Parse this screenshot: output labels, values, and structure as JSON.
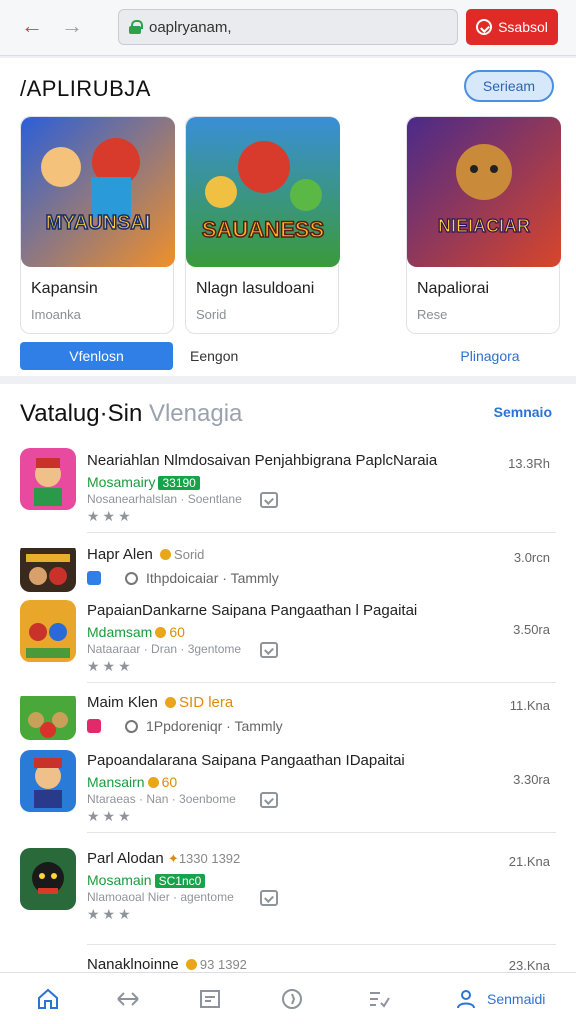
{
  "browser": {
    "url": "oaplryanam,",
    "subscribe_label": "Ssabsol"
  },
  "featured": {
    "title": "/APLIRUBJA",
    "button_label": "Serieam",
    "cards": [
      {
        "name": "Kapansin",
        "sub": "Imoanka",
        "art_text": "MYAUNSAI"
      },
      {
        "name": "Nlagn lasuldoani",
        "sub": "Sorid",
        "art_text": "SAUANESS"
      },
      {
        "name": "Napaliorai",
        "sub": "Rese",
        "art_text": "NIEIACIAR"
      }
    ],
    "chips": [
      "Vfenlosn",
      "Eengon",
      "Plinagora"
    ]
  },
  "catalog": {
    "title_main": "Vatalug·Sin",
    "title_muted": "Vlenagia",
    "link": "Semnaio",
    "items": [
      {
        "title": "Neariahlan Nlmdosaivan Penjahbigrana PaplcNaraia",
        "meta": "Mosamairy",
        "badge": "33190",
        "dev": "Nosanearhalslan · Soentlane",
        "size": "13.3Rh"
      },
      {
        "title": "Hapr Alen",
        "meta2": "Sorid",
        "dev": "Ithpdoicaiar · Tammly",
        "size": "3.0rcn"
      },
      {
        "title": "PapaianDankarne Saipana Pangaathan l Pagaitai",
        "meta": "Mdamsam",
        "badge": "60",
        "dev": "Nataaraar · Dran · 3gentome",
        "size": "3.50ra"
      },
      {
        "title": "Maim Klen",
        "meta2": "SID lera",
        "dev": "1Ppdoreniqr · Tammly",
        "size": "11.Kna"
      },
      {
        "title": "Papoandalarana Saipana Pangaathan IDapaitai",
        "meta": "Mansairn",
        "badge": "60",
        "dev": "Ntaraeas · Nan · 3oenbome",
        "size": "3.30ra"
      },
      {
        "title": "Parl Alodan",
        "meta2": "1330 1392",
        "meta": "Mosamain",
        "badge": "SC1nc0",
        "dev": "Nlamoaoal Nier · agentome",
        "size": "21.Kna"
      },
      {
        "title": "Nanaklnoinne",
        "meta2": "93 1392",
        "size": "23.Kna"
      }
    ]
  },
  "bottom_nav": {
    "active_label": "Senmaidi"
  },
  "colors": {
    "accent": "#2b73d4",
    "red": "#e02a27",
    "green": "#16a34a"
  }
}
